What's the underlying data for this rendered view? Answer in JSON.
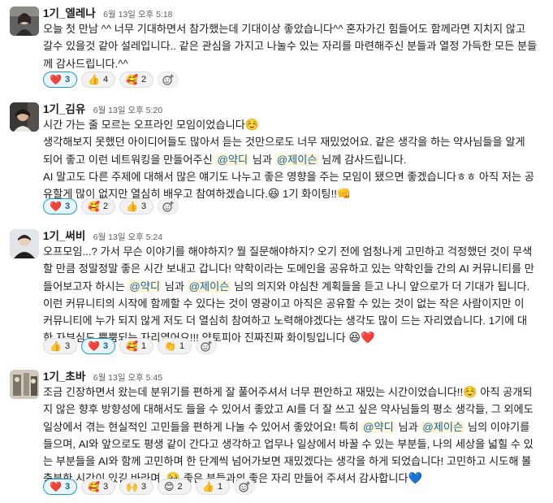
{
  "messages": [
    {
      "author": "1기_엘레나",
      "time": "6월 13일 오후 5:18",
      "lines": [
        "오늘 첫 만남 ^^ 너무 기대하면서 참가했는데 기대이상 좋았습니다^^ 혼자가긴 힘들어도 함께라면 지치지 않고",
        "갈수 있을것 같아 설레입니다.. 같은 관심을 가지고 나눌수 있는 자리를 마련해주신 분들과 열정 가득한 모든 분들",
        "께 감사드립니다.^^"
      ],
      "reactions": [
        {
          "emoji": "❤️",
          "count": "3"
        },
        {
          "emoji": "👍",
          "count": "4"
        },
        {
          "emoji": "🥰",
          "count": "2"
        }
      ]
    },
    {
      "author": "1기_김유",
      "time": "6월 13일 오후 5:20",
      "line1": "시간 가는 줄 모르는 오프라인 모임이었습니다",
      "line1_emoji": "☺️",
      "line2": "생각해보지 못했던 아이디어들도 많아서 듣는 것만으로도 너무 재밌었어요. 같은 생각을 하는 약사님들을 알게",
      "line3_pre": "되어 좋고 이런 네트워킹을 만들어주신 ",
      "mention1": "@약디",
      "line3_mid": " 님과 ",
      "mention2": "@제이슨",
      "line3_post": " 님께 감사드립니다.",
      "line4": "AI 말고도 다른 주제에 대해서 많은 얘기도 나누고 좋은 영향을 주는 모임이 됐으면 좋겠습니다ㅎㅎ 아직 저는 공",
      "line5_pre": "유할게 많이 없지만 열심히 배우고 참여하겠습니다.",
      "line5_emoji1": "😆",
      "line5_post": " 1기 화이팅!!",
      "line5_emoji2": "👊",
      "reactions": [
        {
          "emoji": "❤️",
          "count": "3"
        },
        {
          "emoji": "🥰",
          "count": "2"
        },
        {
          "emoji": "👍",
          "count": "3"
        }
      ]
    },
    {
      "author": "1기_써비",
      "time": "6월 13일 오후 5:24",
      "line1": "오프모임...? 가서 무슨 이야기를 해야하지? 뭘 질문해야하지? 오기 전에 엄청나게 고민하고 걱정했던 것이 무색",
      "line2": "할 만큼 정말정말 좋은 시간 보내고 갑니다! 약학이라는 도메인을 공유하고 있는 약학인들 간의 AI 커뮤니티를 만",
      "line3_pre": "들어보고자 하시는 ",
      "mention1": "@약디",
      "line3_mid": " 님과 ",
      "mention2": "@제이슨",
      "line3_post": " 님의 의지와 야심찬 계획들을 듣고 나니 앞으로가 더 기대가 됩니다.",
      "line4": "이런 커뮤니티의 시작에 함께할 수 있다는 것이 영광이고 아직은 공유할 수 있는 것이 없는 작은 사람이지만 이",
      "line5": "커뮤니티에 누가 되지 않게 저도 더 열심히 참여하고 노력해야겠다는 생각도 많이 드는 자리였습니다. 1기에 대",
      "line6_pre": "한 자부심도 뿜뿜되는 자리였어요!!! 약토피아 진짜진짜 화이팅입니다 ",
      "line6_emoji1": "😆",
      "line6_emoji2": "❤️",
      "reactions": [
        {
          "emoji": "👍",
          "count": "3"
        },
        {
          "emoji": "❤️",
          "count": "3"
        },
        {
          "emoji": "🥰",
          "count": "1"
        },
        {
          "emoji": "👏",
          "count": "1"
        }
      ]
    },
    {
      "author": "1기_초바",
      "time": "6월 13일 오후 5:45",
      "line1_pre": "조금 긴장하면서 왔는데 분위기를 편하게 잘 풀어주셔서 너무 편안하고 재밌는 시간이었습니다!!",
      "line1_emoji": "☺️",
      "line1_post": " 아직 공개되",
      "line2": "지 않은 향후 방향성에 대해서도 들을 수 있어서 좋았고 AI를 더 잘 쓰고 싶은 약사님들의 평소 생각들, 그 외에도",
      "line3_pre": "일상에서 겪는 현실적인 고민들을 편하게 나눌 수 있어서 좋았어요! 특히 ",
      "mention1": "@약디",
      "line3_mid": " 님과 ",
      "mention2": "@제이슨",
      "line3_post": " 님의 이야기를",
      "line4": "들으며, AI와 앞으로도 평생 같이 간다고 생각하고 업무나 일상에서 바꿀 수 있는 부분들, 나의 세상을 넓힐 수 있",
      "line5": "는 부분들을 AI와 함께 고민하며 한 단계씩 넘어가보면 재밌겠다는 생각을 하게 되었습니다! 고민하고 시도해 볼",
      "line6_pre": "충분한 시간이 있길 바라며..",
      "line6_emoji1": "🥹",
      "line6_post": " 좋은 분들과의 좋은 자리 만들어 주셔서 감사합니다",
      "line6_emoji2": "💙",
      "reactions": [
        {
          "emoji": "❤️",
          "count": "3"
        },
        {
          "emoji": "🥰",
          "count": "3"
        },
        {
          "emoji": "🙌",
          "count": "3"
        },
        {
          "emoji": "😊",
          "count": "2"
        },
        {
          "emoji": "👍",
          "count": "1"
        }
      ]
    }
  ]
}
